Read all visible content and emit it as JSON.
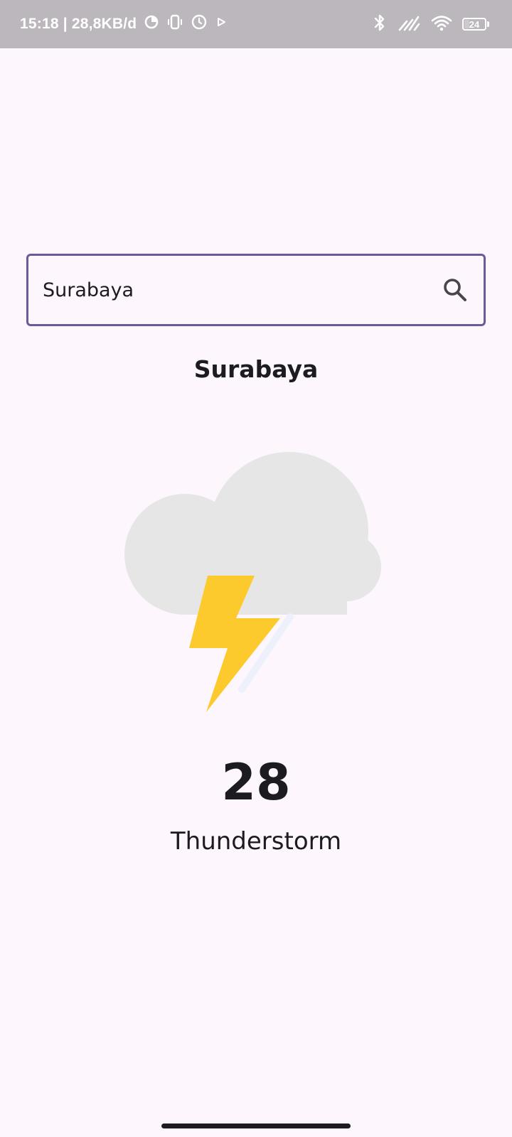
{
  "status_bar": {
    "time_speed": "15:18 | 28,8KB/d",
    "battery_level": "24",
    "battery_fraction": 0.24,
    "icons": [
      "data-saver-icon",
      "vibrate-icon",
      "alarm-icon",
      "play-icon",
      "bluetooth-icon",
      "signal-icon",
      "wifi-icon",
      "battery-icon"
    ]
  },
  "search": {
    "value": "Surabaya",
    "placeholder": "",
    "border_color": "#6a5a9a",
    "icon": "search-icon"
  },
  "weather": {
    "city": "Surabaya",
    "icon": "thunderstorm-icon",
    "temperature": "28",
    "condition": "Thunderstorm"
  },
  "colors": {
    "background": "#fdf7fd",
    "status_bar": "#bcb7bc",
    "cloud": "#e6e6e6",
    "bolt": "#fdca2e",
    "text": "#1c1b1f"
  }
}
